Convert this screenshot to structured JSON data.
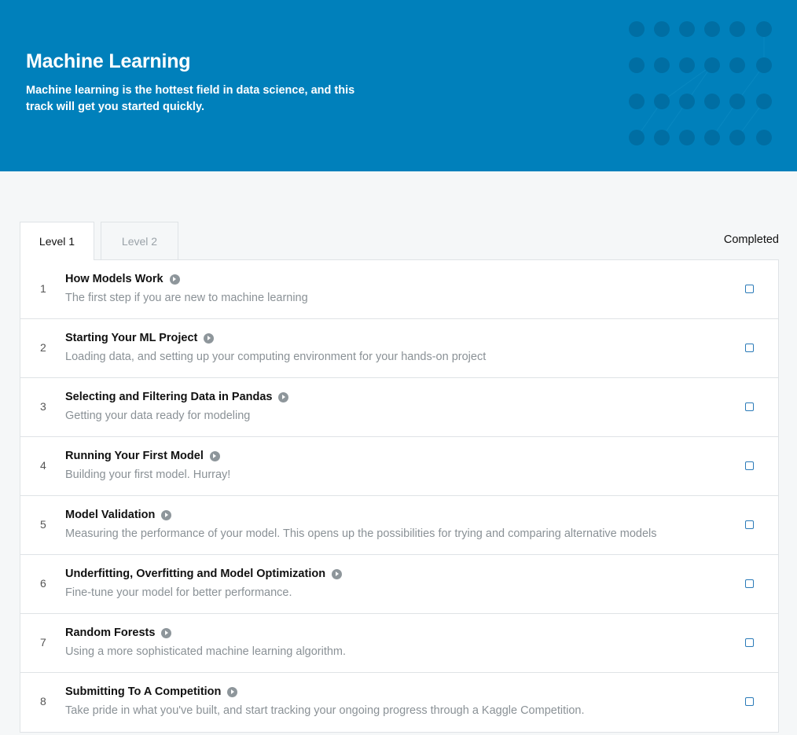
{
  "hero": {
    "title": "Machine Learning",
    "description": "Machine learning is the hottest field in data science, and this track will get you started quickly.",
    "bg_color": "#0080bb",
    "dot_color": "#006ea3"
  },
  "tabs": [
    {
      "label": "Level 1",
      "active": true
    },
    {
      "label": "Level 2",
      "active": false
    }
  ],
  "completed_header": "Completed",
  "lessons": [
    {
      "number": "1",
      "title": "How Models Work",
      "description": "The first step if you are new to machine learning",
      "completed": false
    },
    {
      "number": "2",
      "title": "Starting Your ML Project",
      "description": "Loading data, and setting up your computing environment for your hands-on project",
      "completed": false
    },
    {
      "number": "3",
      "title": "Selecting and Filtering Data in Pandas",
      "description": "Getting your data ready for modeling",
      "completed": false
    },
    {
      "number": "4",
      "title": "Running Your First Model",
      "description": "Building your first model. Hurray!",
      "completed": false
    },
    {
      "number": "5",
      "title": "Model Validation",
      "description": "Measuring the performance of your model. This opens up the possibilities for trying and comparing alternative models",
      "completed": false
    },
    {
      "number": "6",
      "title": "Underfitting, Overfitting and Model Optimization",
      "description": "Fine-tune your model for better performance.",
      "completed": false
    },
    {
      "number": "7",
      "title": "Random Forests",
      "description": "Using a more sophisticated machine learning algorithm.",
      "completed": false
    },
    {
      "number": "8",
      "title": "Submitting To A Competition",
      "description": "Take pride in what you've built, and start tracking your ongoing progress through a Kaggle Competition.",
      "completed": false
    }
  ]
}
